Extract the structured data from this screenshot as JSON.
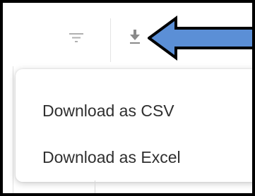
{
  "toolbar": {
    "filter_icon": "filter-icon",
    "download_icon": "download-icon"
  },
  "menu": {
    "items": [
      {
        "label": "Download as CSV"
      },
      {
        "label": "Download as Excel"
      }
    ]
  },
  "annotation": {
    "arrow_color": "#5b8fd6",
    "arrow_outline": "#000000"
  },
  "colors": {
    "icon_gray": "#9a9a9a",
    "text": "#2f2f2f",
    "frame": "#000000"
  }
}
